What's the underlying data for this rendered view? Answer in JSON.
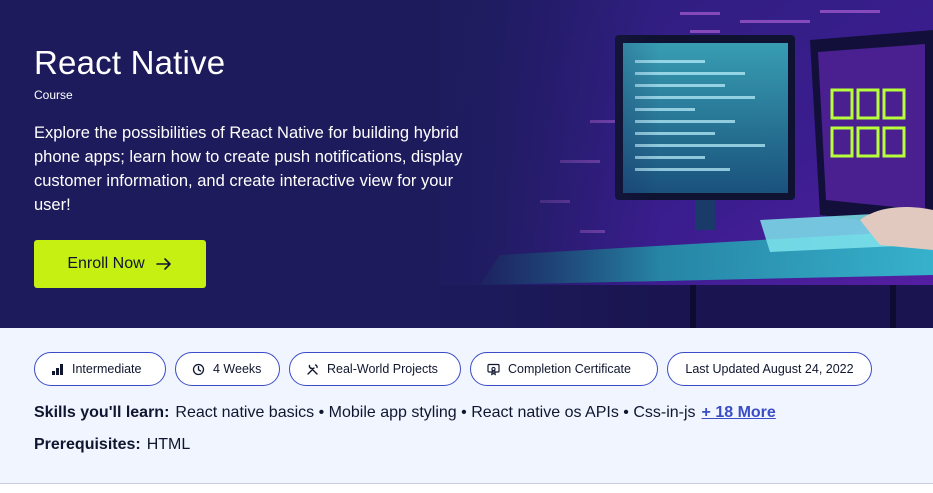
{
  "hero": {
    "title": "React Native",
    "subtitle": "Course",
    "description": "Explore the possibilities of React Native for building hybrid phone apps; learn how to create push notifications, display customer information, and create interactive view for your user!",
    "enroll_label": "Enroll Now",
    "background_color": "#1d1b5c",
    "button_color": "#c6f011",
    "image_icon": "computer-monitors-illustration"
  },
  "chips": [
    {
      "label": "Intermediate",
      "icon": "signal-bars-icon"
    },
    {
      "label": "4 Weeks",
      "icon": "clock-icon"
    },
    {
      "label": "Real-World Projects",
      "icon": "tools-icon"
    },
    {
      "label": "Completion Certificate",
      "icon": "certificate-icon"
    },
    {
      "label": "Last Updated August 24, 2022",
      "icon": ""
    }
  ],
  "skills": {
    "label": "Skills you'll learn:",
    "items": "React native basics • Mobile app styling • React native os APIs • Css-in-js",
    "more_label": "+ 18 More"
  },
  "prerequisites": {
    "label": "Prerequisites:",
    "value": "HTML"
  },
  "colors": {
    "info_background": "#f0f5ff",
    "accent": "#3a4cc7",
    "text": "#10162f"
  }
}
